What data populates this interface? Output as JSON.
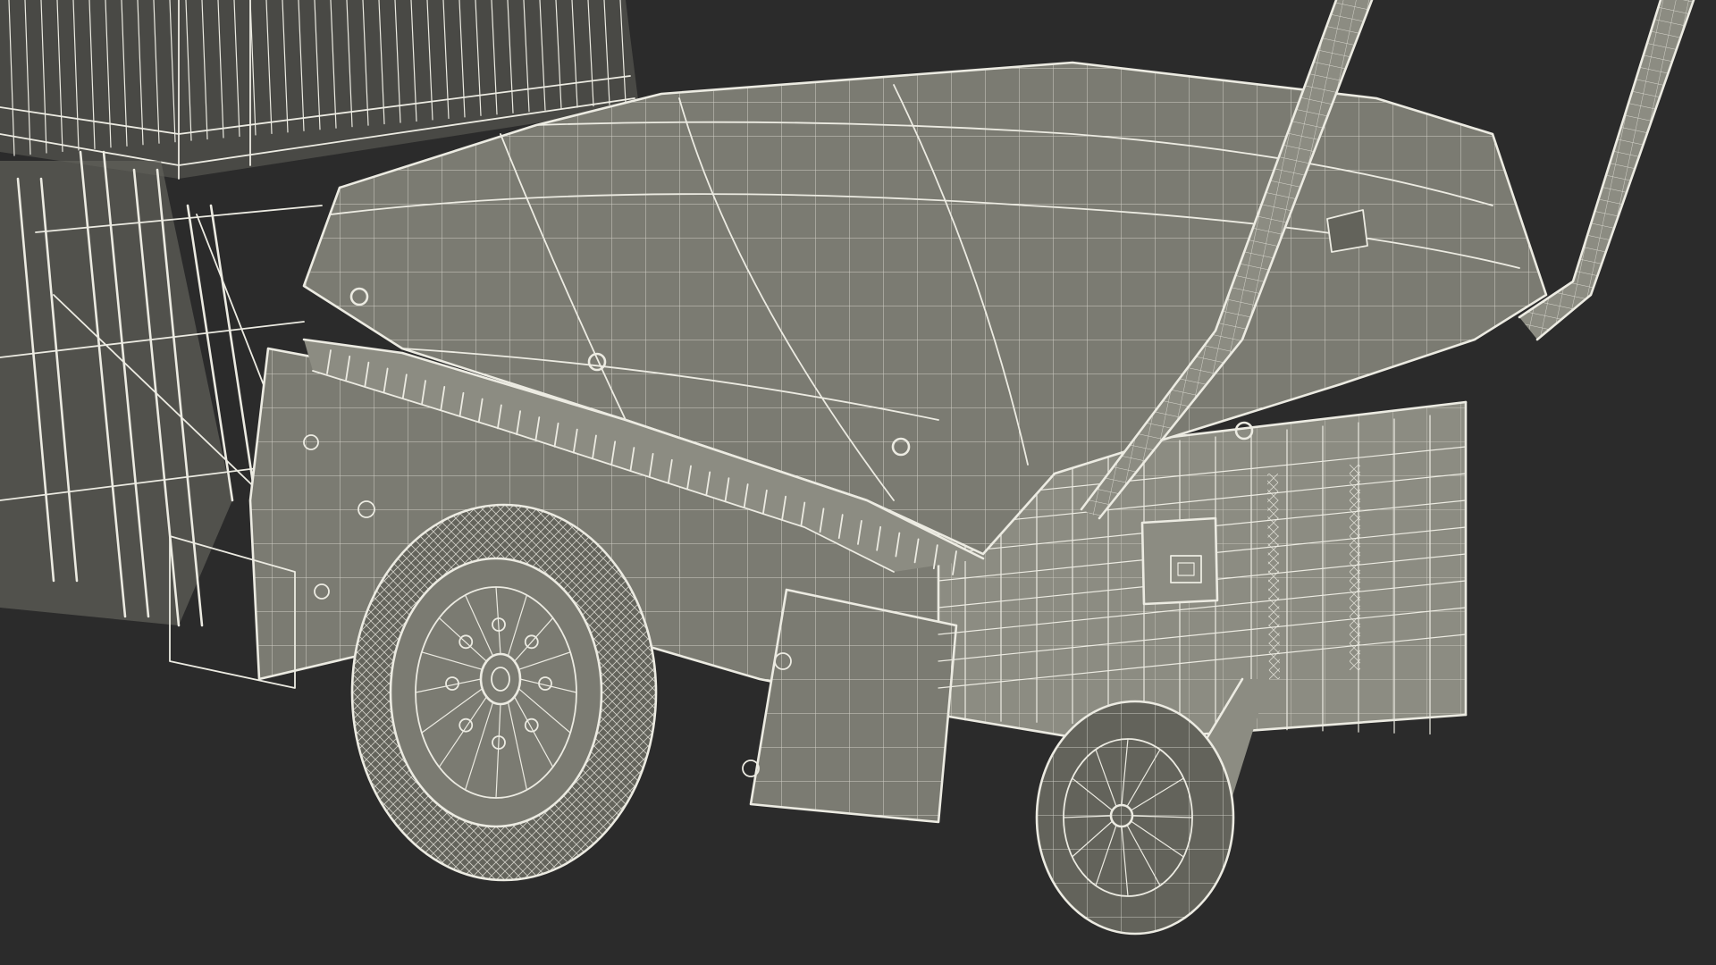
{
  "scene": {
    "subject": "wireframe-render",
    "background_color": "#2b2b2b",
    "surface_color": "#7b7b72",
    "wire_color": "#ecebe2"
  }
}
